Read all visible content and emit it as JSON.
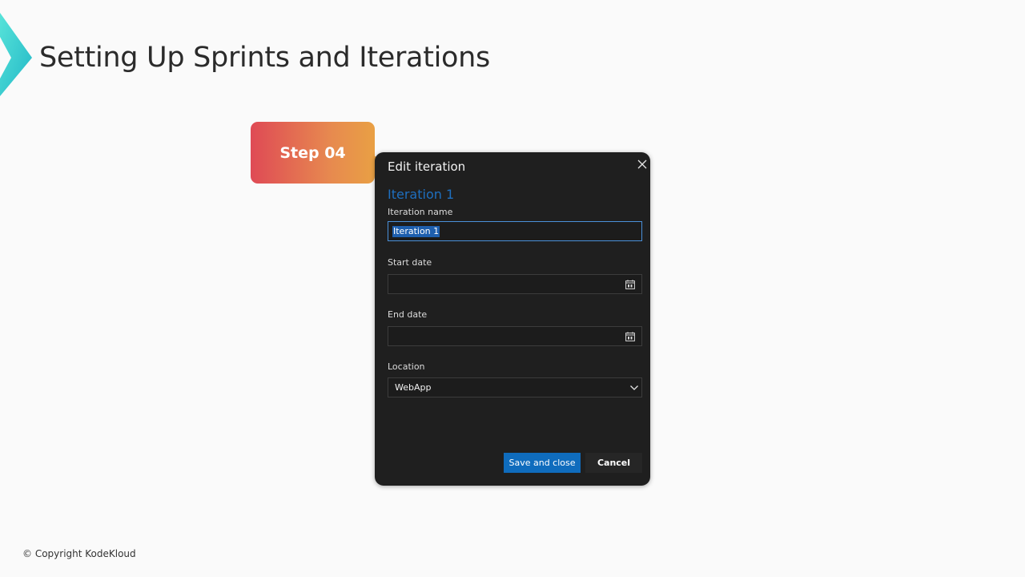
{
  "slide": {
    "title": "Setting Up Sprints and Iterations",
    "step_label": "Step 04",
    "copyright": "© Copyright KodeKloud",
    "logo_icon": "kodekloud-chevron-logo-icon"
  },
  "dialog": {
    "title": "Edit iteration",
    "close_icon": "close-icon",
    "heading": "Iteration 1",
    "fields": {
      "iteration_name": {
        "label": "Iteration name",
        "value": "Iteration 1"
      },
      "start_date": {
        "label": "Start date",
        "value": "",
        "icon": "calendar-icon"
      },
      "end_date": {
        "label": "End date",
        "value": "",
        "icon": "calendar-icon"
      },
      "location": {
        "label": "Location",
        "value": "WebApp",
        "icon": "chevron-down-icon"
      }
    },
    "buttons": {
      "save": "Save and close",
      "cancel": "Cancel"
    }
  },
  "colors": {
    "page_background": "#fafafa",
    "dialog_background": "#1f1f1f",
    "primary_button": "#0f6cbd",
    "heading_blue": "#1e6fbf",
    "step_gradient_start": "#df4a55",
    "step_gradient_end": "#e9a044",
    "logo_teal": "#3dd6d0"
  }
}
